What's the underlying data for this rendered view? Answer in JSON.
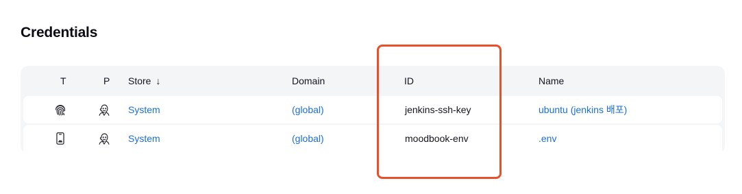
{
  "page": {
    "title": "Credentials"
  },
  "table": {
    "columns": {
      "type": "T",
      "provider": "P",
      "store": "Store",
      "store_sort": "↓",
      "domain": "Domain",
      "id": "ID",
      "name": "Name"
    },
    "rows": [
      {
        "type_icon": "fingerprint-icon",
        "provider_icon": "jenkins-icon",
        "store": "System",
        "domain": "(global)",
        "id": "jenkins-ssh-key",
        "name": "ubuntu (jenkins 배포)"
      },
      {
        "type_icon": "mobile-file-icon",
        "provider_icon": "jenkins-icon",
        "store": "System",
        "domain": "(global)",
        "id": "moodbook-env",
        "name": ".env"
      }
    ]
  },
  "colors": {
    "link": "#1a6fd8",
    "highlight": "#e8502c",
    "header_bg": "#f4f5f7"
  }
}
